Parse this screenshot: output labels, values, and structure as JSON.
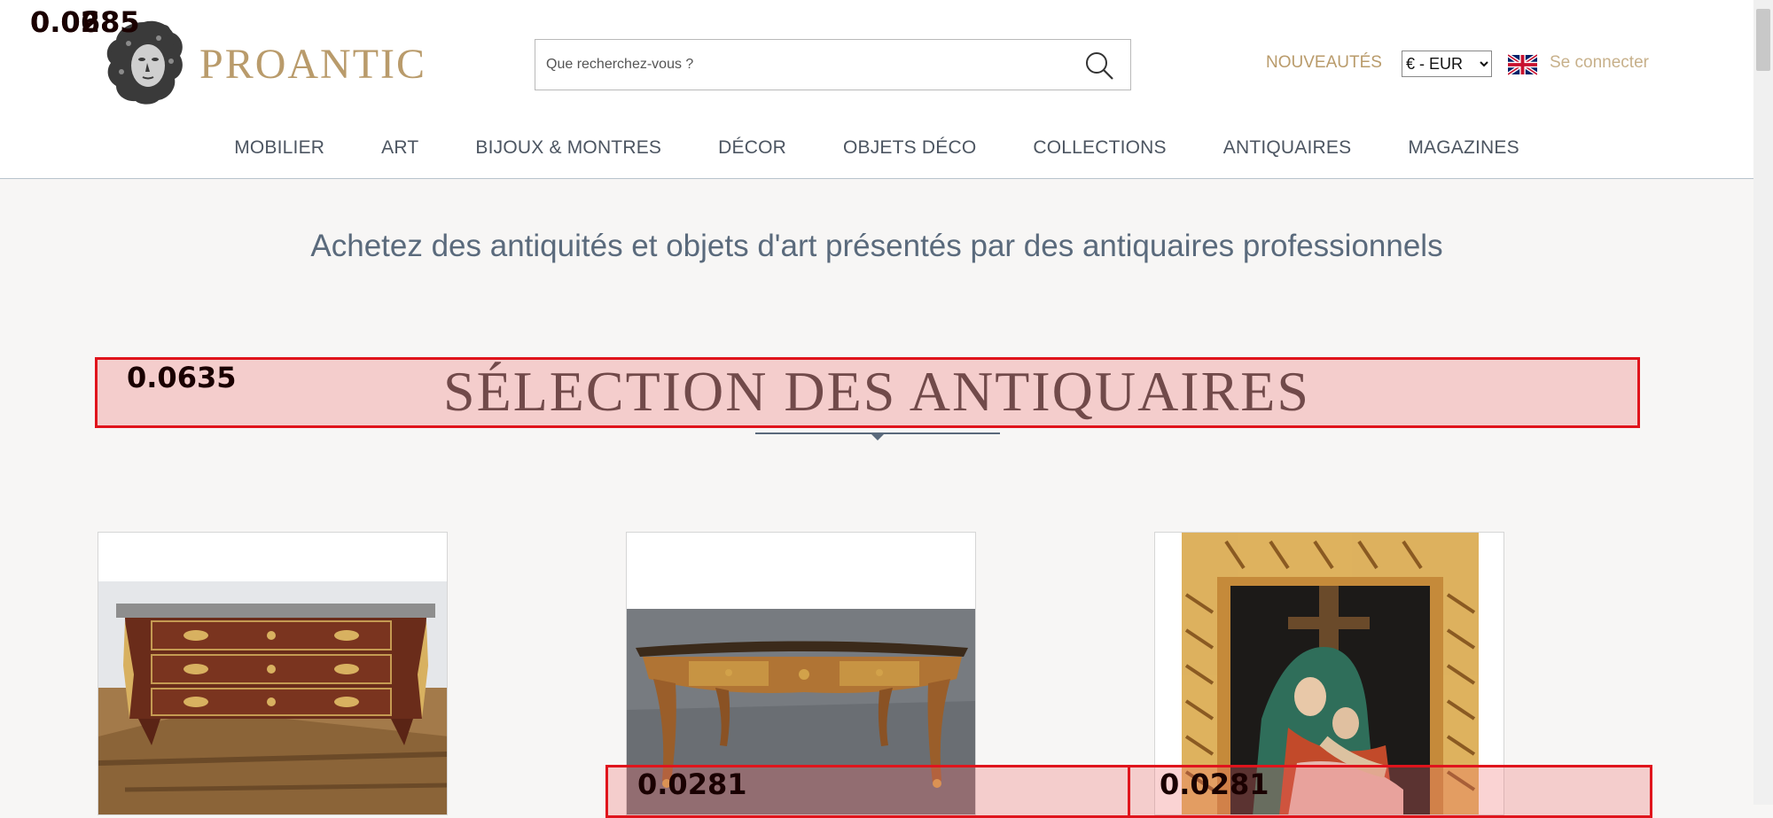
{
  "header": {
    "brand": "PROANTIC",
    "logo_icon": "classical-head-bust-logo",
    "search": {
      "placeholder": "Que recherchez-vous ?",
      "value": ""
    },
    "search_icon": "search-icon",
    "nouveautes": "NOUVEAUTÉS",
    "currency": {
      "selected": "€ - EUR"
    },
    "flag_icon": "uk-flag-icon",
    "login": "Se connecter",
    "accent_color": "#b99b6b"
  },
  "nav": {
    "items": [
      {
        "label": "MOBILIER"
      },
      {
        "label": "ART"
      },
      {
        "label": "BIJOUX & MONTRES"
      },
      {
        "label": "DÉCOR"
      },
      {
        "label": "OBJETS DÉCO"
      },
      {
        "label": "COLLECTIONS"
      },
      {
        "label": "ANTIQUAIRES"
      },
      {
        "label": "MAGAZINES"
      }
    ]
  },
  "main": {
    "tagline": "Achetez des antiquités et objets d'art présentés par des antiquaires professionnels",
    "section_title": "SÉLECTION DES ANTIQUAIRES",
    "cards": [
      {
        "item": "commode-louis-xv-marquetry"
      },
      {
        "item": "bureau-plat-marquetry-desk"
      },
      {
        "item": "pieta-painting-gilded-frame"
      }
    ]
  },
  "overlays": {
    "top_left_scores": [
      "0.0685",
      "0.0285"
    ],
    "section_score": "0.0635",
    "bottom_scores": [
      "0.0281",
      "0.0281"
    ],
    "highlight_color": "#e0141c"
  }
}
